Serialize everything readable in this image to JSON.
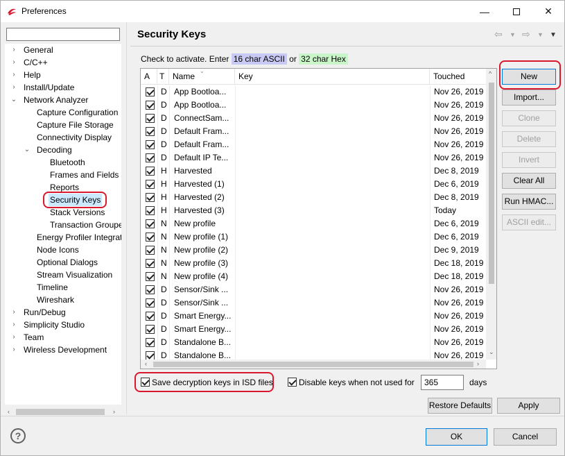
{
  "window": {
    "title": "Preferences"
  },
  "tree": {
    "filter_value": "",
    "items": [
      {
        "label": "General",
        "level": 0,
        "expander": "›"
      },
      {
        "label": "C/C++",
        "level": 0,
        "expander": "›"
      },
      {
        "label": "Help",
        "level": 0,
        "expander": "›"
      },
      {
        "label": "Install/Update",
        "level": 0,
        "expander": "›"
      },
      {
        "label": "Network Analyzer",
        "level": 0,
        "expander": "⌄"
      },
      {
        "label": "Capture Configuration",
        "level": 1,
        "expander": ""
      },
      {
        "label": "Capture File Storage",
        "level": 1,
        "expander": ""
      },
      {
        "label": "Connectivity Display",
        "level": 1,
        "expander": ""
      },
      {
        "label": "Decoding",
        "level": 1,
        "expander": "⌄"
      },
      {
        "label": "Bluetooth",
        "level": 2,
        "expander": ""
      },
      {
        "label": "Frames and Fields",
        "level": 2,
        "expander": ""
      },
      {
        "label": "Reports",
        "level": 2,
        "expander": ""
      },
      {
        "label": "Security Keys",
        "level": 2,
        "expander": "",
        "selected": true
      },
      {
        "label": "Stack Versions",
        "level": 2,
        "expander": ""
      },
      {
        "label": "Transaction Groupe",
        "level": 2,
        "expander": ""
      },
      {
        "label": "Energy Profiler Integrati",
        "level": 1,
        "expander": ""
      },
      {
        "label": "Node Icons",
        "level": 1,
        "expander": ""
      },
      {
        "label": "Optional Dialogs",
        "level": 1,
        "expander": ""
      },
      {
        "label": "Stream Visualization",
        "level": 1,
        "expander": ""
      },
      {
        "label": "Timeline",
        "level": 1,
        "expander": ""
      },
      {
        "label": "Wireshark",
        "level": 1,
        "expander": ""
      },
      {
        "label": "Run/Debug",
        "level": 0,
        "expander": "›"
      },
      {
        "label": "Simplicity Studio",
        "level": 0,
        "expander": "›"
      },
      {
        "label": "Team",
        "level": 0,
        "expander": "›"
      },
      {
        "label": "Wireless Development",
        "level": 0,
        "expander": "›"
      }
    ]
  },
  "page": {
    "title": "Security Keys",
    "instructions": {
      "prefix": "Check to activate. Enter",
      "ascii": "16 char ASCII",
      "middle": "or",
      "hex": "32 char Hex"
    }
  },
  "table": {
    "columns": [
      "A",
      "T",
      "Name",
      "Key",
      "Touched"
    ],
    "rows": [
      {
        "t": "D",
        "name": "App Bootloa...",
        "touched": "Nov 26, 2019"
      },
      {
        "t": "D",
        "name": "App Bootloa...",
        "touched": "Nov 26, 2019"
      },
      {
        "t": "D",
        "name": "ConnectSam...",
        "touched": "Nov 26, 2019"
      },
      {
        "t": "D",
        "name": "Default Fram...",
        "touched": "Nov 26, 2019"
      },
      {
        "t": "D",
        "name": "Default Fram...",
        "touched": "Nov 26, 2019"
      },
      {
        "t": "D",
        "name": "Default IP Te...",
        "touched": "Nov 26, 2019"
      },
      {
        "t": "H",
        "name": "Harvested",
        "touched": "Dec 8, 2019"
      },
      {
        "t": "H",
        "name": "Harvested (1)",
        "touched": "Dec 6, 2019"
      },
      {
        "t": "H",
        "name": "Harvested (2)",
        "touched": "Dec 8, 2019"
      },
      {
        "t": "H",
        "name": "Harvested (3)",
        "touched": "Today"
      },
      {
        "t": "N",
        "name": "New profile",
        "touched": "Dec 6, 2019"
      },
      {
        "t": "N",
        "name": "New profile (1)",
        "touched": "Dec 6, 2019"
      },
      {
        "t": "N",
        "name": "New profile (2)",
        "touched": "Dec 9, 2019"
      },
      {
        "t": "N",
        "name": "New profile (3)",
        "touched": "Dec 18, 2019"
      },
      {
        "t": "N",
        "name": "New profile (4)",
        "touched": "Dec 18, 2019"
      },
      {
        "t": "D",
        "name": "Sensor/Sink ...",
        "touched": "Nov 26, 2019"
      },
      {
        "t": "D",
        "name": "Sensor/Sink ...",
        "touched": "Nov 26, 2019"
      },
      {
        "t": "D",
        "name": "Smart Energy...",
        "touched": "Nov 26, 2019"
      },
      {
        "t": "D",
        "name": "Smart Energy...",
        "touched": "Nov 26, 2019"
      },
      {
        "t": "D",
        "name": "Standalone B...",
        "touched": "Nov 26, 2019"
      },
      {
        "t": "D",
        "name": "Standalone B...",
        "touched": "Nov 26, 2019"
      }
    ]
  },
  "buttons": {
    "new": "New",
    "import": "Import...",
    "clone": "Clone",
    "delete": "Delete",
    "invert": "Invert",
    "clear_all": "Clear All",
    "run_hmac": "Run HMAC...",
    "ascii_edit": "ASCII edit...",
    "restore_defaults": "Restore Defaults",
    "apply": "Apply",
    "ok": "OK",
    "cancel": "Cancel"
  },
  "options": {
    "save_keys_label": "Save decryption keys in ISD files",
    "save_keys_checked": true,
    "disable_keys_label": "Disable keys when not used for",
    "disable_keys_checked": true,
    "days_value": "365",
    "days_unit": "days"
  },
  "colors": {
    "ascii_highlight": "#c9c9f5",
    "hex_highlight": "#c9f5c9",
    "annotation_red": "#d9182d",
    "selection": "#cce8ff"
  }
}
